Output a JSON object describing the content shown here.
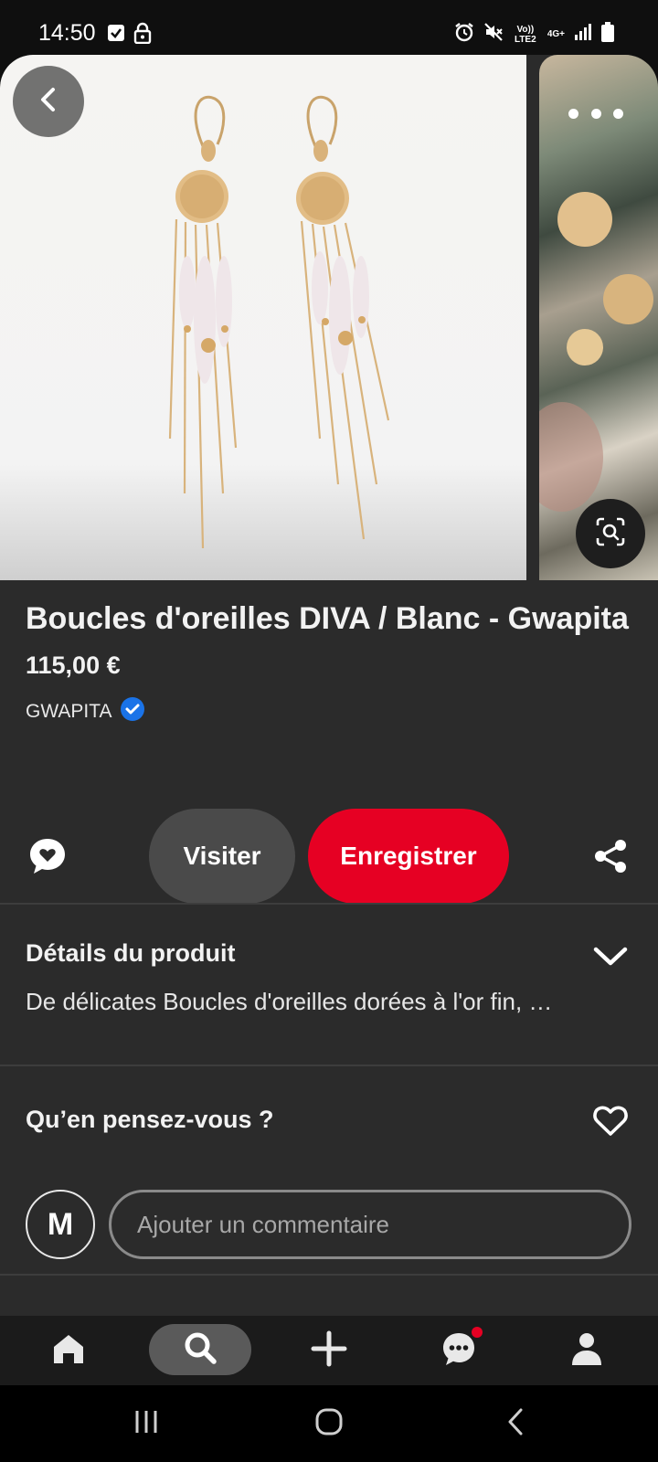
{
  "status_bar": {
    "time": "14:50",
    "network_label": "Vo)) LTE2",
    "network_type": "4G+",
    "icons": [
      "checkbox-notification-icon",
      "lock-icon",
      "alarm-icon",
      "mute-icon",
      "signal-icon",
      "battery-icon"
    ]
  },
  "pin": {
    "title": "Boucles d'oreilles DIVA / Blanc - Gwapita",
    "price": "115,00 €",
    "merchant": "GWAPITA",
    "merchant_verified": true
  },
  "actions": {
    "visit_label": "Visiter",
    "save_label": "Enregistrer"
  },
  "details": {
    "heading": "Détails du produit",
    "text": "De délicates Boucles d'oreilles dorées à l'or fin, …"
  },
  "feedback": {
    "heading": "Qu’en pensez-vous ?",
    "avatar_initial": "M",
    "comment_placeholder": "Ajouter un commentaire"
  },
  "bottom_nav": {
    "items": [
      "home-icon",
      "search-icon",
      "plus-icon",
      "messages-icon",
      "profile-icon"
    ],
    "active": "search-icon",
    "messages_has_notification": true
  },
  "colors": {
    "accent": "#e60023",
    "background": "#2b2b2b",
    "verified": "#1a73e8"
  }
}
